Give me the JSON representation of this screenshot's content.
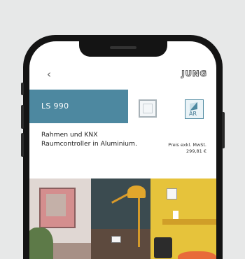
{
  "header": {
    "back_glyph": "‹",
    "brand_logo": "JUNG"
  },
  "product": {
    "name": "LS 990",
    "description": "Rahmen und KNX Raumcontroller in Aluminium.",
    "price_label": "Preis exkl. MwSt.",
    "price_value": "299,81 €"
  },
  "ar_button": {
    "label": "AR"
  },
  "colors": {
    "accent": "#4d88a0",
    "background": "#e7e8e8",
    "phone_frame": "#141414"
  },
  "icons": [
    "back-chevron-icon",
    "frame-icon",
    "ar-cube-icon"
  ]
}
